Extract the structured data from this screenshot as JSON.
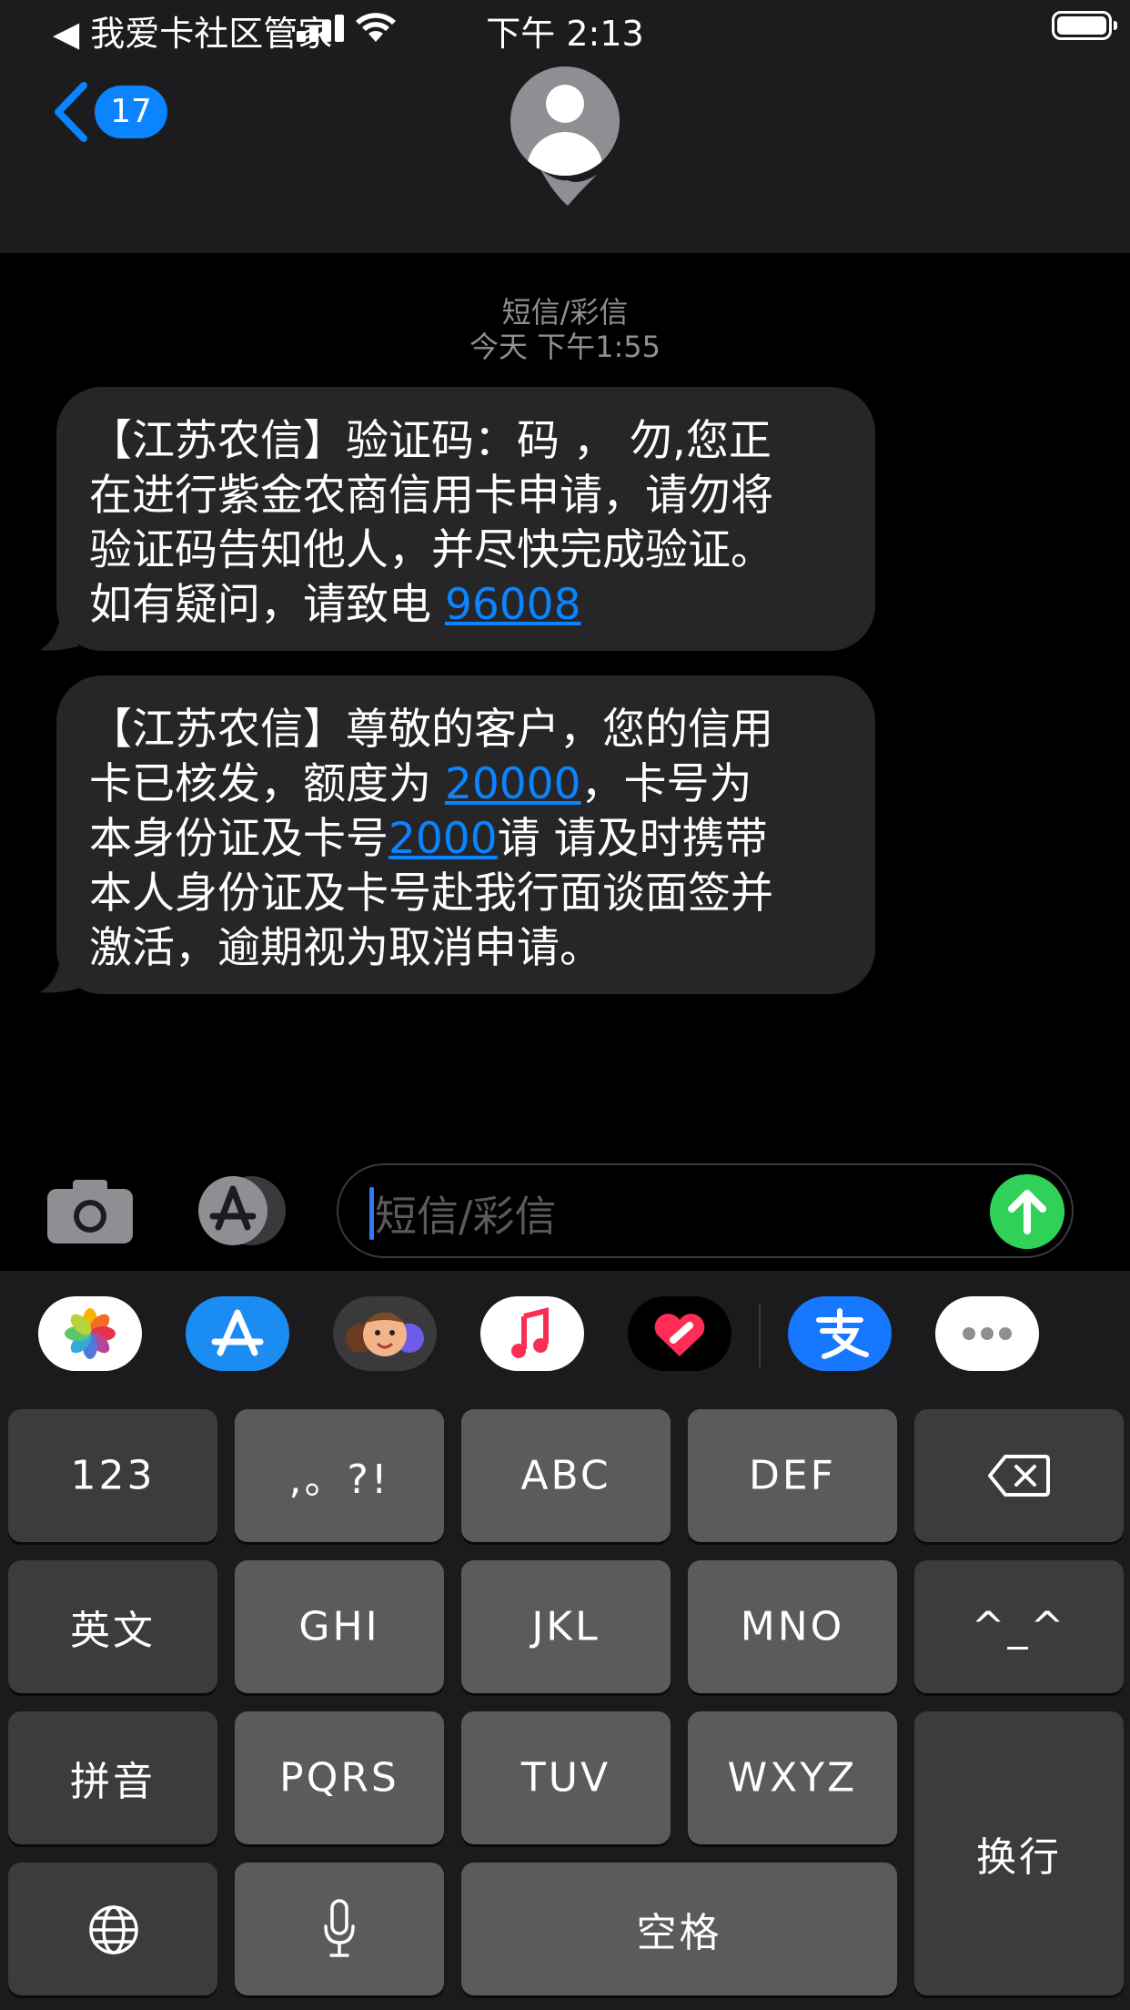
{
  "status_bar": {
    "back_app_label": "◀ 我爱卡社区管家",
    "time": "下午 2:13"
  },
  "nav": {
    "unread_count": "17"
  },
  "conversation": {
    "message_type": "短信/彩信",
    "timestamp": "今天 下午1:55",
    "messages": [
      {
        "lines": [
          "【江苏农信】验证码：码 ， 勿,您正",
          "在进行紫金农商信用卡申请，请勿将",
          "验证码告知他人，并尽快完成验证。"
        ],
        "last_prefix": "如有疑问，请致电 ",
        "link": "96008",
        "last_suffix": ""
      },
      {
        "line1": "【江苏农信】尊敬的客户，您的信用",
        "line2_prefix": "卡已核发，额度为 ",
        "line2_link": "20000",
        "line2_suffix": "，卡号为",
        "line3_prefix": "本身份证及卡号",
        "line3_link": "2000",
        "line3_suffix": "请 请及时携带",
        "line4": "本人身份证及卡号赴我行面谈面签并",
        "line5": "激活，逾期视为取消申请。"
      }
    ]
  },
  "composer": {
    "placeholder": "短信/彩信"
  },
  "app_strip": {
    "icons": [
      "photos-icon",
      "app-store-icon",
      "memoji-icon",
      "music-icon",
      "digital-touch-icon",
      "alipay-icon",
      "more-icon"
    ]
  },
  "keyboard": {
    "keys": {
      "num": "123",
      "punct": ",。?!",
      "abc": "ABC",
      "def": "DEF",
      "english": "英文",
      "ghi": "GHI",
      "jkl": "JKL",
      "mno": "MNO",
      "emoticon": "^_^",
      "pinyin": "拼音",
      "pqrs": "PQRS",
      "tuv": "TUV",
      "wxyz": "WXYZ",
      "return": "换行",
      "space": "空格"
    }
  },
  "colors": {
    "accent_blue": "#0a84ff",
    "send_green": "#30d158",
    "bubble_gray": "#262628"
  }
}
